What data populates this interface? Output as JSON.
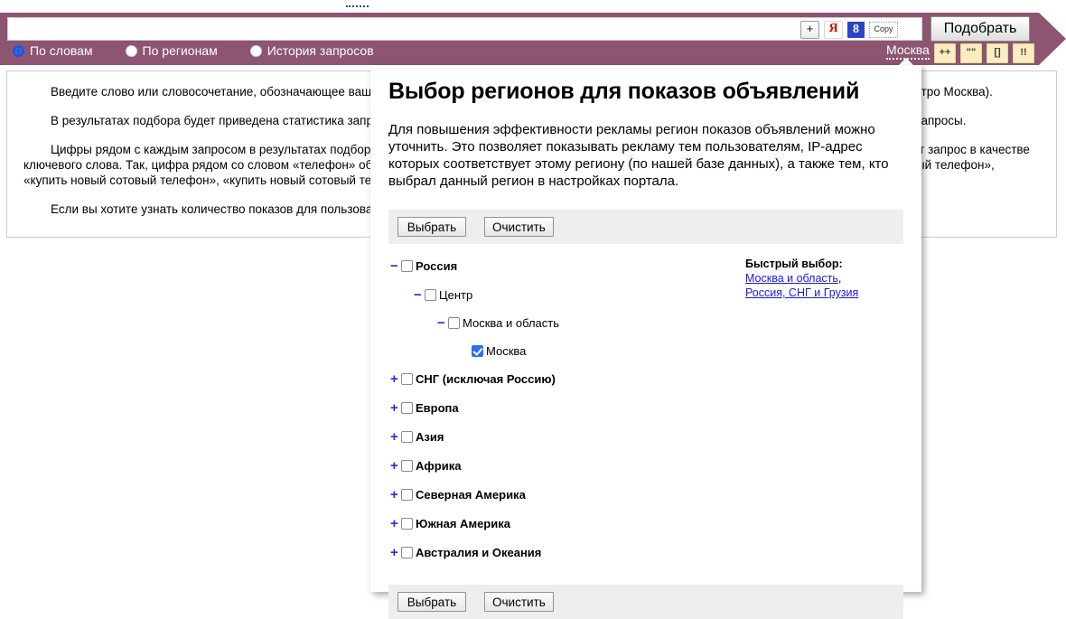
{
  "header": {
    "search_value": "",
    "search_placeholder": "",
    "submit_label": "Подобрать",
    "region_link": "Москва",
    "radios": [
      {
        "label": "По словам",
        "selected": true
      },
      {
        "label": "По регионам",
        "selected": false
      },
      {
        "label": "История запросов",
        "selected": false
      }
    ],
    "input_tools": [
      {
        "name": "add-icon",
        "glyph": "+"
      },
      {
        "name": "yandex-icon",
        "glyph": "Я"
      },
      {
        "name": "google-icon",
        "glyph": "8"
      },
      {
        "name": "copy-icon",
        "glyph": "Copy"
      }
    ],
    "operators": [
      {
        "name": "plus-plus-operator",
        "glyph": "++"
      },
      {
        "name": "quotes-operator",
        "glyph": "\"\""
      },
      {
        "name": "brackets-operator",
        "glyph": "[]"
      },
      {
        "name": "exclamation-operator",
        "glyph": "!!"
      }
    ]
  },
  "background": {
    "paragraphs": [
      "Введите слово или словосочетание, обозначающее ваш товар или услугу, и нажмите кнопку «Подобрать» (например, покупка квартиры в Москве или метро Москва).",
      "В результатах подбора будет приведена статистика запросов на Яндексе, включающих заданное вами слово или словосочетание, и приведены другие запросы.",
      "Цифры рядом с каждым запросом в результатах подбора слов дают предварительный прогноз числа показов в месяц, которое вы получите, выбрав этот запрос в качестве ключевого слова. Так, цифра рядом со словом «телефон» обозначает число показов по всем запросам, включающим «телефон»: «купить телефон», «сотовый телефон», «купить новый сотовый телефон»,  «купить новый сотовый телефон в крапинку» и т.п.",
      "Если вы хотите узнать количество показов для пользователей определённого региона, выберите его в списке регионов."
    ]
  },
  "dialog": {
    "title": "Выбор регионов для показов объявлений",
    "description": "Для повышения эффективности рекламы регион показов объявлений можно уточнить. Это позволяет показывать рекламу тем пользователям, IP-адрес которых соответствует этому региону (по нашей базе данных), а также тем, кто выбрал данный регион в настройках портала.",
    "actions": {
      "select_label": "Выбрать",
      "clear_label": "Очистить"
    },
    "quick_select": {
      "title": "Быстрый выбор:",
      "links": [
        {
          "label": "Москва и область",
          "trailing": ","
        },
        {
          "label": "Россия, СНГ и Грузия",
          "trailing": ""
        }
      ]
    },
    "tree": [
      {
        "label": "Россия",
        "toggle": "−",
        "checked": false,
        "indent": 0,
        "bold": true
      },
      {
        "label": "Центр",
        "toggle": "−",
        "checked": false,
        "indent": 1,
        "bold": false
      },
      {
        "label": "Москва и область",
        "toggle": "−",
        "checked": false,
        "indent": 2,
        "bold": false
      },
      {
        "label": "Москва",
        "toggle": "",
        "checked": true,
        "indent": 3,
        "bold": false
      },
      {
        "label": "СНГ (исключая Россию)",
        "toggle": "+",
        "checked": false,
        "indent": 0,
        "bold": true
      },
      {
        "label": "Европа",
        "toggle": "+",
        "checked": false,
        "indent": 0,
        "bold": true
      },
      {
        "label": "Азия",
        "toggle": "+",
        "checked": false,
        "indent": 0,
        "bold": true
      },
      {
        "label": "Африка",
        "toggle": "+",
        "checked": false,
        "indent": 0,
        "bold": true
      },
      {
        "label": "Северная Америка",
        "toggle": "+",
        "checked": false,
        "indent": 0,
        "bold": true
      },
      {
        "label": "Южная Америка",
        "toggle": "+",
        "checked": false,
        "indent": 0,
        "bold": true
      },
      {
        "label": "Австралия и Океания",
        "toggle": "+",
        "checked": false,
        "indent": 0,
        "bold": true
      }
    ]
  },
  "colors": {
    "header_purple": "#8d5571",
    "link_blue": "#1a1ae0",
    "toggle_blue": "#2b2be0",
    "checkbox_blue": "#2a73e8",
    "operator_yellow": "#fbedc0",
    "panel_gray": "#eeeeee"
  }
}
